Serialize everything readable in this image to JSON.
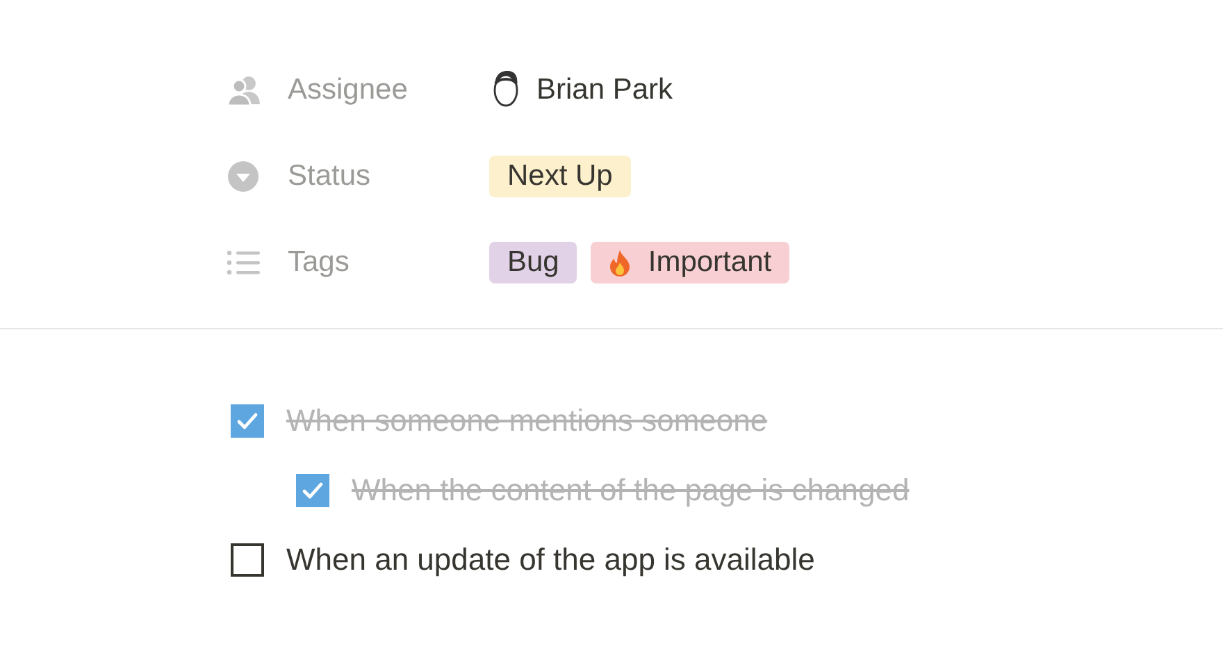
{
  "properties": [
    {
      "kind": "person",
      "label": "Assignee",
      "value": "Brian Park"
    },
    {
      "kind": "select",
      "label": "Status",
      "value": "Next Up",
      "color": "#fdf0cc"
    },
    {
      "kind": "multi_select",
      "label": "Tags",
      "tags": [
        {
          "label": "Bug",
          "color": "#e2d2e8",
          "kind": "plain"
        },
        {
          "label": "Important",
          "color": "#f8cfd3",
          "kind": "fire"
        }
      ]
    }
  ],
  "todos": [
    {
      "text": "When someone mentions someone",
      "checked": true,
      "children": [
        {
          "text": "When the content of the page is changed",
          "checked": true
        }
      ]
    },
    {
      "text": "When an update of the app is available",
      "checked": false
    }
  ]
}
